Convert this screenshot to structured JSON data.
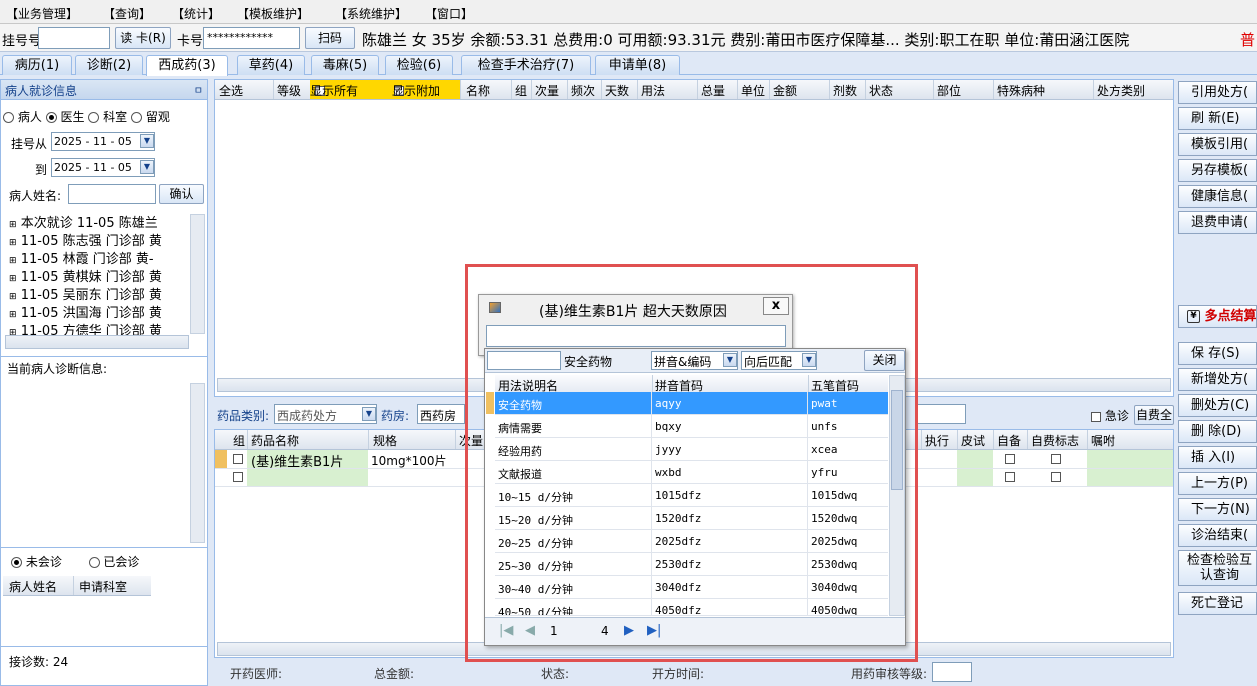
{
  "menu": [
    "【业务管理】",
    "【查询】",
    "【统计】",
    "【模板维护】",
    "【系统维护】",
    "【窗口】"
  ],
  "info": {
    "guahao_label": "挂号号",
    "read_card": "读 卡(R)",
    "card_label": "卡号",
    "card_value": "************",
    "scan": "扫码",
    "patient_text": "陈雄兰  女  35岁  余额:53.31  总费用:0  可用额:93.31元  费别:莆田市医疗保障基...  类别:职工在职  单位:莆田涵江医院",
    "extra": "普"
  },
  "tabs": [
    "病历(1)",
    "诊断(2)",
    "西成药(3)",
    "草药(4)",
    "毒麻(5)",
    "检验(6)",
    "检查手术治疗(7)",
    "申请单(8)"
  ],
  "left": {
    "title": "病人就诊信息",
    "pin": "ㅁ",
    "radios": [
      "病人",
      "医生",
      "科室",
      "留观"
    ],
    "from_label": "挂号从",
    "from_date": "2025 - 11 - 05",
    "to_label": "到",
    "to_date": "2025 - 11 - 05",
    "name_label": "病人姓名:",
    "confirm": "确认",
    "tree": [
      "本次就诊 11-05 陈雄兰",
      "11-05 陈志强 门诊部 黄",
      "11-05 林霞 门诊部 黄-",
      "11-05 黄棋妹 门诊部 黄",
      "11-05 吴丽东 门诊部 黄",
      "11-05 洪国海 门诊部 黄",
      "11-05 方德华 门诊部 黄"
    ],
    "diag_title": "当前病人诊断信息:",
    "consult_radios": [
      "未会诊",
      "已会诊"
    ],
    "consult_cols": [
      "病人姓名",
      "申请科室"
    ],
    "count": "接诊数: 24"
  },
  "top_grid": {
    "cols": [
      "全选",
      "等级",
      "显示所有",
      "显示附加",
      "名称",
      "组",
      "次量",
      "频次",
      "天数",
      "用法",
      "总量",
      "单位",
      "金额",
      "剂数",
      "状态",
      "部位",
      "特殊病种",
      "处方类别"
    ]
  },
  "rx": {
    "type_label": "药品类别:",
    "type_value": "西成药处方",
    "pharmacy_label": "药房:",
    "pharmacy_value": "西药房",
    "urgent": "急诊",
    "selfpay": "自费全"
  },
  "bottom_grid": {
    "cols": [
      "组",
      "药品名称",
      "规格",
      "次量",
      "执行",
      "皮试",
      "自备",
      "自费标志",
      "嘱咐"
    ],
    "row_name": "(基)维生素B1片",
    "row_spec": "10mg*100片"
  },
  "status": {
    "doctor": "开药医师:",
    "total": "总金额:",
    "state": "状态:",
    "time": "开方时间:",
    "audit": "用药审核等级:"
  },
  "right_buttons": [
    "引用处方(",
    "刷 新(E)",
    "模板引用(",
    "另存模板(",
    "健康信息(",
    "退费申请(",
    "多点结算",
    "保 存(S)",
    "新增处方(",
    "删处方(C)",
    "删 除(D)",
    "插 入(I)",
    "上一方(P)",
    "下一方(N)",
    "诊治结束(",
    "检查检验互认查询",
    "死亡登记"
  ],
  "dialog": {
    "title": "(基)维生素B1片 超大天数原因",
    "close": "x"
  },
  "popup": {
    "search_value": "",
    "safe_label": "安全药物",
    "mode": "拼音&编码",
    "match": "向后匹配",
    "close": "关闭",
    "cols": [
      "用法说明名",
      "拼音首码",
      "五笔首码"
    ],
    "rows": [
      [
        "安全药物",
        "aqyy",
        "pwat"
      ],
      [
        "病情需要",
        "bqxy",
        "unfs"
      ],
      [
        "经验用药",
        "jyyy",
        "xcea"
      ],
      [
        "文献报道",
        "wxbd",
        "yfru"
      ],
      [
        "10~15 d/分钟",
        "1015dfz",
        "1015dwq"
      ],
      [
        "15~20 d/分钟",
        "1520dfz",
        "1520dwq"
      ],
      [
        "20~25 d/分钟",
        "2025dfz",
        "2025dwq"
      ],
      [
        "25~30 d/分钟",
        "2530dfz",
        "2530dwq"
      ],
      [
        "30~40 d/分钟",
        "3040dfz",
        "3040dwq"
      ],
      [
        "40~50 d/分钟",
        "4050dfz",
        "4050dwq"
      ]
    ],
    "page": "1",
    "pages": "4"
  },
  "colors": {
    "highlight": "#ffd700",
    "select": "#3399ff",
    "annotation": "#e05050",
    "green": "#d8f0d0"
  }
}
